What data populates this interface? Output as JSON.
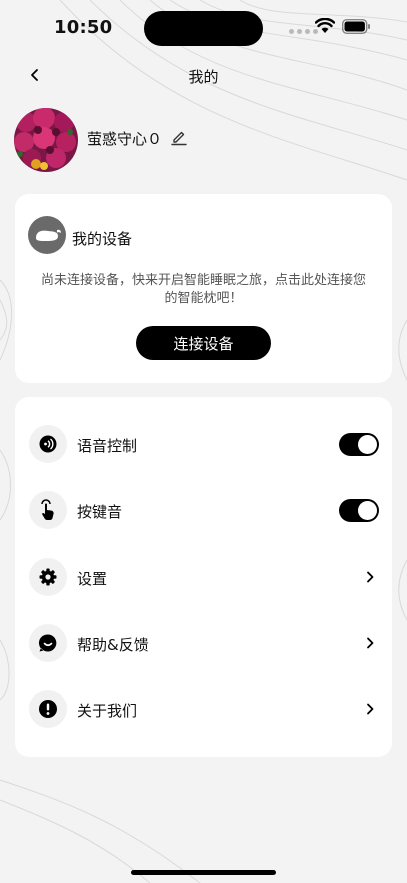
{
  "status_bar": {
    "time": "10:50"
  },
  "nav": {
    "title": "我的"
  },
  "profile": {
    "username": "萤惑守心０"
  },
  "device_card": {
    "title": "我的设备",
    "description": "尚未连接设备，快来开启智能睡眠之旅，点击此处连接您的智能枕吧！",
    "button_label": "连接设备"
  },
  "menu": {
    "items": [
      {
        "label": "语音控制",
        "control": "toggle",
        "on": true,
        "icon": "voice-icon"
      },
      {
        "label": "按键音",
        "control": "toggle",
        "on": true,
        "icon": "tap-icon"
      },
      {
        "label": "设置",
        "control": "chevron",
        "icon": "gear-icon"
      },
      {
        "label": "帮助&反馈",
        "control": "chevron",
        "icon": "smile-chat-icon"
      },
      {
        "label": "关于我们",
        "control": "chevron",
        "icon": "info-icon"
      }
    ]
  },
  "colors": {
    "background": "#f3f3f3",
    "card": "#ffffff",
    "accent": "#000000",
    "icon_bg": "#f1f1f1"
  }
}
